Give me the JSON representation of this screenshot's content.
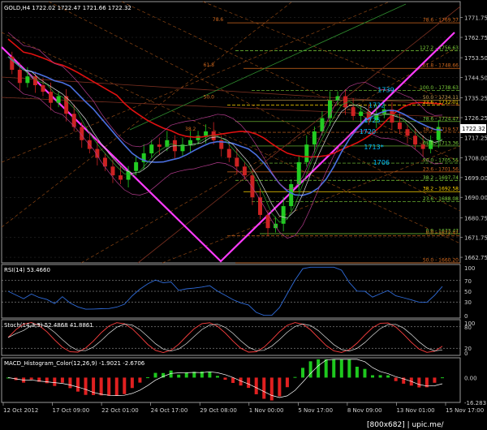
{
  "watermark": "[800x682] | upic.me/",
  "chart_data": [
    {
      "type": "line",
      "title": "GOLD,H4  1722.02 1722.47 1721.66 1722.32",
      "ylim": [
        1660.2,
        1779.0
      ],
      "y_ticks": [
        1771.75,
        1762.75,
        1753.5,
        1744.5,
        1735.25,
        1726.25,
        1717.25,
        1708.0,
        1699.0,
        1690.0,
        1680.75,
        1671.75,
        1662.75
      ],
      "current_price": "1722.32",
      "fib_levels": [
        {
          "label": "78.6 - 1769.37",
          "y": 1769.37,
          "color": "#d2691e"
        },
        {
          "label": "127.2 - 1756.63",
          "y": 1756.63,
          "color": "#7ccf3a"
        },
        {
          "label": "61.8 - 1748.66",
          "y": 1748.66,
          "color": "#d2691e"
        },
        {
          "label": "100.0 - 1738.63",
          "y": 1738.63,
          "color": "#7ccf3a"
        },
        {
          "label": "50.0 - 1734.11",
          "y": 1734.11,
          "color": "#c8a050"
        },
        {
          "label": "23.6 - 1732.01",
          "y": 1732.01,
          "color": "#ffd700"
        },
        {
          "label": "78.6 - 1724.47",
          "y": 1724.47,
          "color": "#7ccf3a"
        },
        {
          "label": "38.2 - 1719.57",
          "y": 1719.57,
          "color": "#d2691e"
        },
        {
          "label": "61.8 - 1713.36",
          "y": 1713.36,
          "color": "#7ccf3a"
        },
        {
          "label": "50.0 - 1705.55",
          "y": 1705.55,
          "color": "#7ccf3a"
        },
        {
          "label": "23.6 - 1701.56",
          "y": 1701.56,
          "color": "#d2691e"
        },
        {
          "label": "38.2 - 1697.74",
          "y": 1697.74,
          "color": "#7ccf3a"
        },
        {
          "label": "38.2 - 1692.58",
          "y": 1692.58,
          "color": "#ffd700"
        },
        {
          "label": "23.6 - 1688.08",
          "y": 1688.08,
          "color": "#7ccf3a"
        },
        {
          "label": "0.0 - 1673.47",
          "y": 1673.47,
          "color": "#7ccf3a"
        },
        {
          "label": "0.0 - 1672.47",
          "y": 1672.47,
          "color": "#d2691e"
        },
        {
          "label": "50.0 - 1660.20",
          "y": 1660.2,
          "color": "#d2691e"
        }
      ],
      "chart_fib_marks": [
        {
          "label": "78.6",
          "y": 1769.37,
          "x_frac": 0.46
        },
        {
          "label": "61.8",
          "y": 1748.66,
          "x_frac": 0.44
        },
        {
          "label": "50.0",
          "y": 1734.11,
          "x_frac": 0.44
        },
        {
          "label": "38.2",
          "y": 1719.57,
          "x_frac": 0.4
        }
      ],
      "price_annotations": [
        {
          "label": "1739",
          "y": 1739.0,
          "x_frac": 0.82
        },
        {
          "label": "1732",
          "y": 1732.0,
          "x_frac": 0.8
        },
        {
          "label": "1725",
          "y": 1725.2,
          "x_frac": 0.79
        },
        {
          "label": "1720",
          "y": 1720.0,
          "x_frac": 0.78
        },
        {
          "label": "1713*",
          "y": 1713.0,
          "x_frac": 0.79
        },
        {
          "label": "1706",
          "y": 1706.0,
          "x_frac": 0.81
        }
      ]
    },
    {
      "type": "line",
      "title": "RSI(14) 53.4660",
      "ylim": [
        0,
        100
      ],
      "y_ticks": [
        100,
        70,
        50,
        30,
        0
      ]
    },
    {
      "type": "line",
      "title": "Stoch(14,3,3) 52.4868 41.8861",
      "ylim": [
        0,
        100
      ],
      "y_ticks": [
        100,
        80,
        20,
        0
      ]
    },
    {
      "type": "bar",
      "title": "MACD_Histogram_Color(12,26,9) -1.9021 -2.6706",
      "ylim": [
        -16.283,
        13.0
      ],
      "y_ticks": [
        0.0,
        -16.283
      ]
    }
  ],
  "x_axis": {
    "tick_labels": [
      "12 Oct 2012",
      "17 Oct 09:00",
      "22 Oct 01:00",
      "24 Oct 17:00",
      "29 Oct 08:00",
      "1 Nov 00:00",
      "5 Nov 17:00",
      "8 Nov 09:00",
      "13 Nov 01:00",
      "15 Nov 17:00"
    ]
  }
}
